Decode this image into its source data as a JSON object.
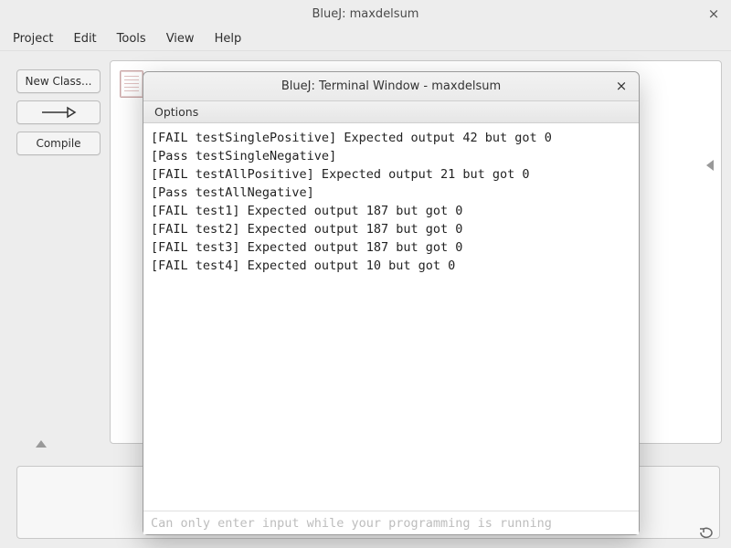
{
  "main_window": {
    "title": "BlueJ:  maxdelsum",
    "close_glyph": "×"
  },
  "menubar": {
    "items": [
      "Project",
      "Edit",
      "Tools",
      "View",
      "Help"
    ]
  },
  "left_panel": {
    "new_class_label": "New Class...",
    "compile_label": "Compile"
  },
  "terminal": {
    "title": "BlueJ: Terminal Window - maxdelsum",
    "close_glyph": "×",
    "menubar": {
      "options_label": "Options"
    },
    "lines": [
      "[FAIL testSinglePositive] Expected output 42 but got 0",
      "[Pass testSingleNegative]",
      "[FAIL testAllPositive] Expected output 21 but got 0",
      "[Pass testAllNegative]",
      "[FAIL test1] Expected output 187 but got 0",
      "[FAIL test2] Expected output 187 but got 0",
      "[FAIL test3] Expected output 187 but got 0",
      "[FAIL test4] Expected output 10 but got 0"
    ],
    "footer_hint": "Can only enter input while your programming is running"
  }
}
